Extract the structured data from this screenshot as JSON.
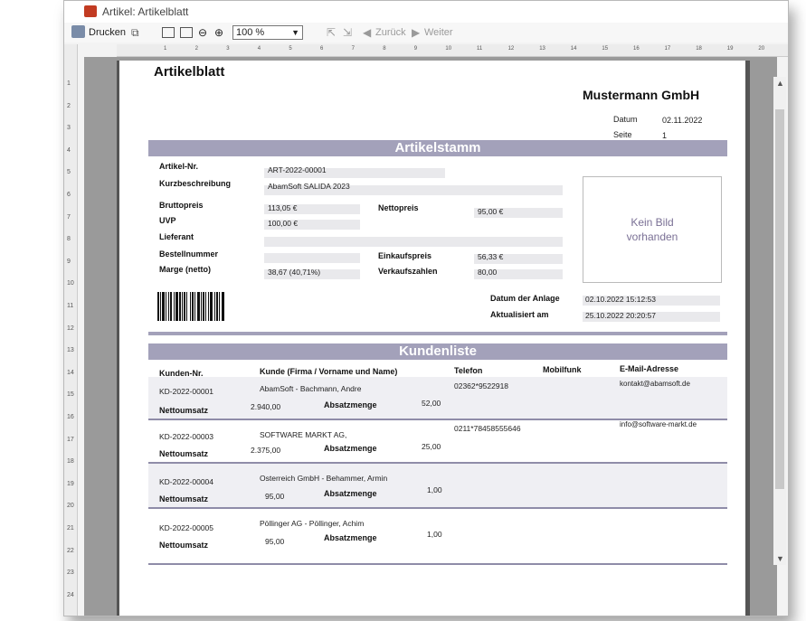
{
  "window": {
    "title": "Artikel: Artikelblatt",
    "controls": {
      "minimize": "—",
      "maximize": "☐",
      "close": "✕"
    }
  },
  "toolbar": {
    "print_label": "Drucken",
    "zoom_value": "100 %",
    "back_label": "Zurück",
    "forward_label": "Weiter"
  },
  "ruler": {
    "h_ticks": [
      "1",
      "2",
      "3",
      "4",
      "5",
      "6",
      "7",
      "8",
      "9",
      "10",
      "11",
      "12",
      "13",
      "14",
      "15",
      "16",
      "17",
      "18",
      "19",
      "20"
    ],
    "v_ticks": [
      "1",
      "2",
      "3",
      "4",
      "5",
      "6",
      "7",
      "8",
      "9",
      "10",
      "11",
      "12",
      "13",
      "14",
      "15",
      "16",
      "17",
      "18",
      "19",
      "20",
      "21",
      "22",
      "23",
      "24"
    ]
  },
  "report": {
    "title": "Artikelblatt",
    "company": "Mustermann GmbH",
    "date_label": "Datum",
    "date_value": "02.11.2022",
    "page_label": "Seite",
    "page_value": "1",
    "section_article": "Artikelstamm",
    "section_customers": "Kundenliste"
  },
  "article": {
    "number_label": "Artikel-Nr.",
    "number_value": "ART-2022-00001",
    "short_desc_label": "Kurzbeschreibung",
    "short_desc_value": "AbamSoft SALIDA 2023",
    "gross_label": "Bruttopreis",
    "gross_value": "113,05 €",
    "net_label": "Nettopreis",
    "net_value": "95,00 €",
    "rrp_label": "UVP",
    "rrp_value": "100,00 €",
    "supplier_label": "Lieferant",
    "order_no_label": "Bestellnummer",
    "purchase_label": "Einkaufspreis",
    "purchase_value": "56,33 €",
    "margin_label": "Marge (netto)",
    "margin_value": "38,67   (40,71%)",
    "sales_label": "Verkaufszahlen",
    "sales_value": "80,00",
    "no_image_text": "Kein Bild vorhanden",
    "created_label": "Datum der Anlage",
    "created_value": "02.10.2022 15:12:53",
    "updated_label": "Aktualisiert am",
    "updated_value": "25.10.2022 20:20:57"
  },
  "customers": {
    "headers": {
      "number": "Kunden-Nr.",
      "customer": "Kunde (Firma / Vorname und Name)",
      "phone": "Telefon",
      "mobile": "Mobilfunk",
      "email": "E-Mail-Adresse"
    },
    "sales_label": "Nettoumsatz",
    "qty_label": "Absatzmenge",
    "rows": [
      {
        "number": "KD-2022-00001",
        "name": "AbamSoft - Bachmann, Andre",
        "phone": "02362*9522918",
        "email": "kontakt@abamsoft.de",
        "sales": "2.940,00",
        "qty": "52,00"
      },
      {
        "number": "KD-2022-00003",
        "name": "SOFTWARE MARKT AG,",
        "phone": "0211*78458555646",
        "email": "info@software-markt.de",
        "sales": "2.375,00",
        "qty": "25,00"
      },
      {
        "number": "KD-2022-00004",
        "name": "Osterreich GmbH - Behammer, Armin",
        "phone": "",
        "email": "",
        "sales": "95,00",
        "qty": "1,00"
      },
      {
        "number": "KD-2022-00005",
        "name": "Pöllinger AG - Pöllinger, Achim",
        "phone": "",
        "email": "",
        "sales": "95,00",
        "qty": "1,00"
      }
    ]
  }
}
